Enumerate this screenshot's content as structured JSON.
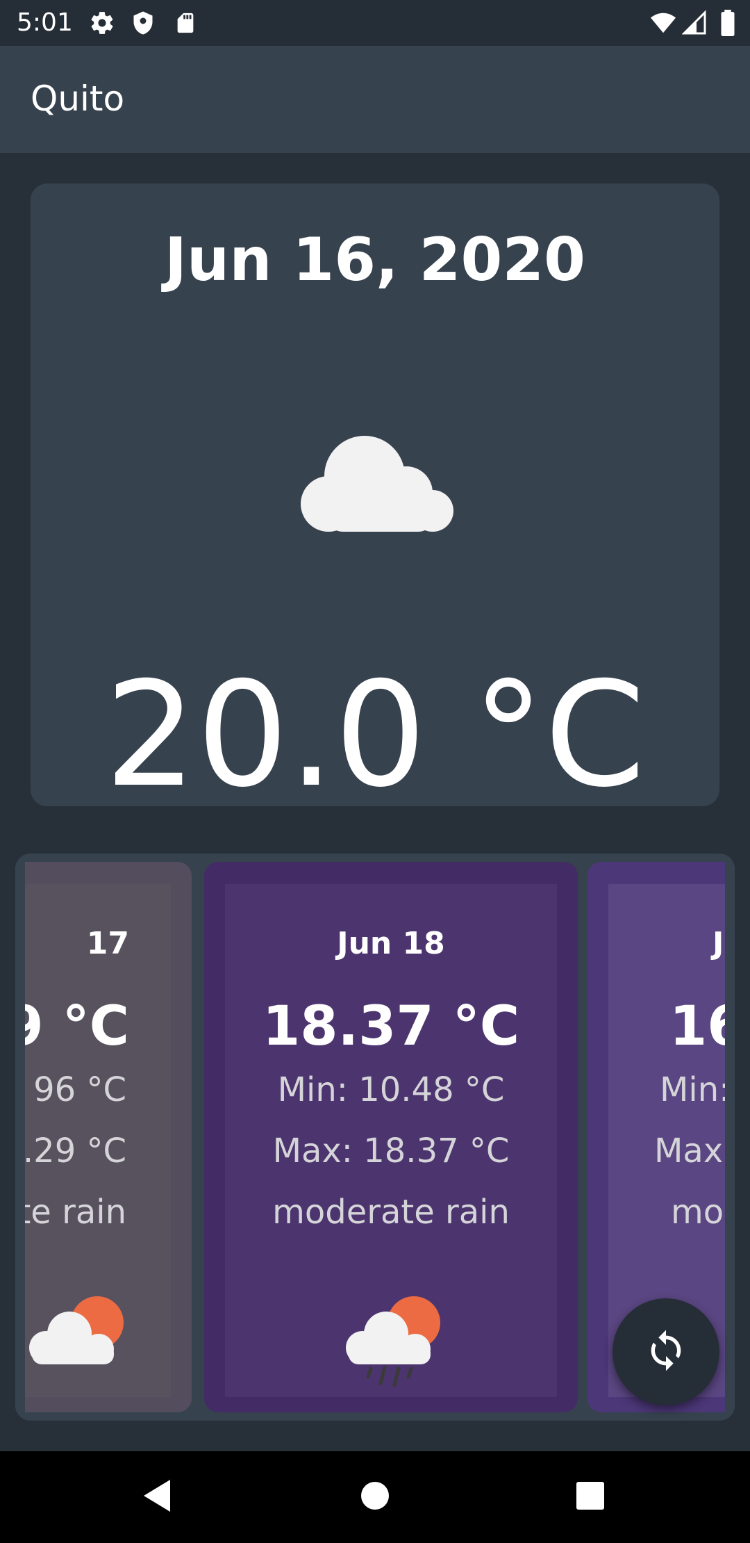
{
  "status_bar": {
    "time": "5:01",
    "left_icons": [
      "settings-icon",
      "shield-icon",
      "sd-card-icon"
    ],
    "right_icons": [
      "wifi-icon",
      "signal-icon",
      "battery-icon"
    ]
  },
  "app_bar": {
    "title": "Quito"
  },
  "current": {
    "date": "Jun 16, 2020",
    "icon": "cloud-icon",
    "temperature": "20.0 °C"
  },
  "forecast": [
    {
      "date": "17",
      "temperature": "9 °C",
      "min": "96 °C",
      "max": ".29 °C",
      "description": "te rain",
      "icon": "rain-sun-icon"
    },
    {
      "date": "Jun 18",
      "temperature": "18.37 °C",
      "min": "Min: 10.48 °C",
      "max": "Max: 18.37 °C",
      "description": "moderate rain",
      "icon": "rain-sun-icon"
    },
    {
      "date": "J",
      "temperature": "16",
      "min": "Min:",
      "max": "Max",
      "description": "moc",
      "icon": "rain-sun-icon"
    }
  ],
  "fab": {
    "icon": "refresh-icon"
  },
  "nav_bar": {
    "buttons": [
      "back-icon",
      "home-icon",
      "recents-icon"
    ]
  },
  "colors": {
    "background": "#273039",
    "surface": "#37424f",
    "card_left": "#58525f",
    "card_mid": "#4c346e",
    "card_right": "#5a4682"
  }
}
